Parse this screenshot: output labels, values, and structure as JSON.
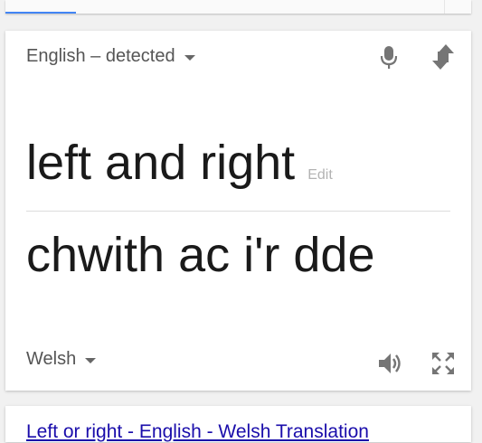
{
  "translator": {
    "source_language": "English – detected",
    "target_language": "Welsh",
    "source_text": "left and right",
    "edit_label": "Edit",
    "translated_text": "chwith ac i'r dde"
  },
  "icons": {
    "mic": "microphone-icon",
    "swap": "swap-languages-icon",
    "speaker": "speaker-icon",
    "fullscreen": "fullscreen-icon"
  },
  "search_result": {
    "title": "Left or right - English - Welsh Translation"
  },
  "colors": {
    "accent": "#4285f4",
    "link": "#1a0dab",
    "icon": "#757575"
  }
}
